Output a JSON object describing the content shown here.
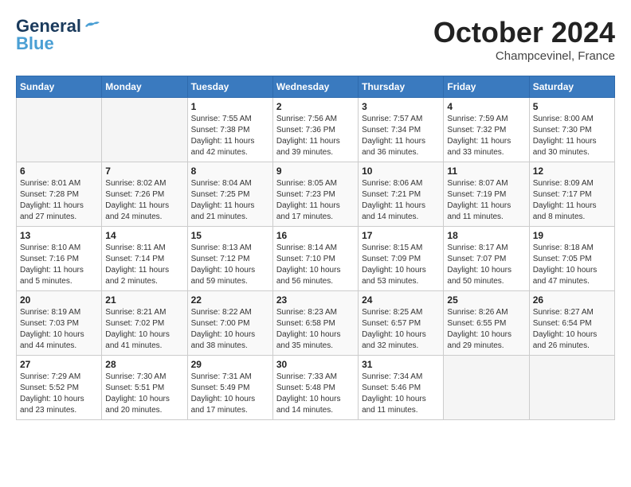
{
  "header": {
    "logo_general": "General",
    "logo_blue": "Blue",
    "month_title": "October 2024",
    "location": "Champcevinel, France"
  },
  "days_of_week": [
    "Sunday",
    "Monday",
    "Tuesday",
    "Wednesday",
    "Thursday",
    "Friday",
    "Saturday"
  ],
  "weeks": [
    [
      {
        "day": null,
        "sunrise": null,
        "sunset": null,
        "daylight": null
      },
      {
        "day": null,
        "sunrise": null,
        "sunset": null,
        "daylight": null
      },
      {
        "day": "1",
        "sunrise": "Sunrise: 7:55 AM",
        "sunset": "Sunset: 7:38 PM",
        "daylight": "Daylight: 11 hours and 42 minutes."
      },
      {
        "day": "2",
        "sunrise": "Sunrise: 7:56 AM",
        "sunset": "Sunset: 7:36 PM",
        "daylight": "Daylight: 11 hours and 39 minutes."
      },
      {
        "day": "3",
        "sunrise": "Sunrise: 7:57 AM",
        "sunset": "Sunset: 7:34 PM",
        "daylight": "Daylight: 11 hours and 36 minutes."
      },
      {
        "day": "4",
        "sunrise": "Sunrise: 7:59 AM",
        "sunset": "Sunset: 7:32 PM",
        "daylight": "Daylight: 11 hours and 33 minutes."
      },
      {
        "day": "5",
        "sunrise": "Sunrise: 8:00 AM",
        "sunset": "Sunset: 7:30 PM",
        "daylight": "Daylight: 11 hours and 30 minutes."
      }
    ],
    [
      {
        "day": "6",
        "sunrise": "Sunrise: 8:01 AM",
        "sunset": "Sunset: 7:28 PM",
        "daylight": "Daylight: 11 hours and 27 minutes."
      },
      {
        "day": "7",
        "sunrise": "Sunrise: 8:02 AM",
        "sunset": "Sunset: 7:26 PM",
        "daylight": "Daylight: 11 hours and 24 minutes."
      },
      {
        "day": "8",
        "sunrise": "Sunrise: 8:04 AM",
        "sunset": "Sunset: 7:25 PM",
        "daylight": "Daylight: 11 hours and 21 minutes."
      },
      {
        "day": "9",
        "sunrise": "Sunrise: 8:05 AM",
        "sunset": "Sunset: 7:23 PM",
        "daylight": "Daylight: 11 hours and 17 minutes."
      },
      {
        "day": "10",
        "sunrise": "Sunrise: 8:06 AM",
        "sunset": "Sunset: 7:21 PM",
        "daylight": "Daylight: 11 hours and 14 minutes."
      },
      {
        "day": "11",
        "sunrise": "Sunrise: 8:07 AM",
        "sunset": "Sunset: 7:19 PM",
        "daylight": "Daylight: 11 hours and 11 minutes."
      },
      {
        "day": "12",
        "sunrise": "Sunrise: 8:09 AM",
        "sunset": "Sunset: 7:17 PM",
        "daylight": "Daylight: 11 hours and 8 minutes."
      }
    ],
    [
      {
        "day": "13",
        "sunrise": "Sunrise: 8:10 AM",
        "sunset": "Sunset: 7:16 PM",
        "daylight": "Daylight: 11 hours and 5 minutes."
      },
      {
        "day": "14",
        "sunrise": "Sunrise: 8:11 AM",
        "sunset": "Sunset: 7:14 PM",
        "daylight": "Daylight: 11 hours and 2 minutes."
      },
      {
        "day": "15",
        "sunrise": "Sunrise: 8:13 AM",
        "sunset": "Sunset: 7:12 PM",
        "daylight": "Daylight: 10 hours and 59 minutes."
      },
      {
        "day": "16",
        "sunrise": "Sunrise: 8:14 AM",
        "sunset": "Sunset: 7:10 PM",
        "daylight": "Daylight: 10 hours and 56 minutes."
      },
      {
        "day": "17",
        "sunrise": "Sunrise: 8:15 AM",
        "sunset": "Sunset: 7:09 PM",
        "daylight": "Daylight: 10 hours and 53 minutes."
      },
      {
        "day": "18",
        "sunrise": "Sunrise: 8:17 AM",
        "sunset": "Sunset: 7:07 PM",
        "daylight": "Daylight: 10 hours and 50 minutes."
      },
      {
        "day": "19",
        "sunrise": "Sunrise: 8:18 AM",
        "sunset": "Sunset: 7:05 PM",
        "daylight": "Daylight: 10 hours and 47 minutes."
      }
    ],
    [
      {
        "day": "20",
        "sunrise": "Sunrise: 8:19 AM",
        "sunset": "Sunset: 7:03 PM",
        "daylight": "Daylight: 10 hours and 44 minutes."
      },
      {
        "day": "21",
        "sunrise": "Sunrise: 8:21 AM",
        "sunset": "Sunset: 7:02 PM",
        "daylight": "Daylight: 10 hours and 41 minutes."
      },
      {
        "day": "22",
        "sunrise": "Sunrise: 8:22 AM",
        "sunset": "Sunset: 7:00 PM",
        "daylight": "Daylight: 10 hours and 38 minutes."
      },
      {
        "day": "23",
        "sunrise": "Sunrise: 8:23 AM",
        "sunset": "Sunset: 6:58 PM",
        "daylight": "Daylight: 10 hours and 35 minutes."
      },
      {
        "day": "24",
        "sunrise": "Sunrise: 8:25 AM",
        "sunset": "Sunset: 6:57 PM",
        "daylight": "Daylight: 10 hours and 32 minutes."
      },
      {
        "day": "25",
        "sunrise": "Sunrise: 8:26 AM",
        "sunset": "Sunset: 6:55 PM",
        "daylight": "Daylight: 10 hours and 29 minutes."
      },
      {
        "day": "26",
        "sunrise": "Sunrise: 8:27 AM",
        "sunset": "Sunset: 6:54 PM",
        "daylight": "Daylight: 10 hours and 26 minutes."
      }
    ],
    [
      {
        "day": "27",
        "sunrise": "Sunrise: 7:29 AM",
        "sunset": "Sunset: 5:52 PM",
        "daylight": "Daylight: 10 hours and 23 minutes."
      },
      {
        "day": "28",
        "sunrise": "Sunrise: 7:30 AM",
        "sunset": "Sunset: 5:51 PM",
        "daylight": "Daylight: 10 hours and 20 minutes."
      },
      {
        "day": "29",
        "sunrise": "Sunrise: 7:31 AM",
        "sunset": "Sunset: 5:49 PM",
        "daylight": "Daylight: 10 hours and 17 minutes."
      },
      {
        "day": "30",
        "sunrise": "Sunrise: 7:33 AM",
        "sunset": "Sunset: 5:48 PM",
        "daylight": "Daylight: 10 hours and 14 minutes."
      },
      {
        "day": "31",
        "sunrise": "Sunrise: 7:34 AM",
        "sunset": "Sunset: 5:46 PM",
        "daylight": "Daylight: 10 hours and 11 minutes."
      },
      {
        "day": null,
        "sunrise": null,
        "sunset": null,
        "daylight": null
      },
      {
        "day": null,
        "sunrise": null,
        "sunset": null,
        "daylight": null
      }
    ]
  ]
}
